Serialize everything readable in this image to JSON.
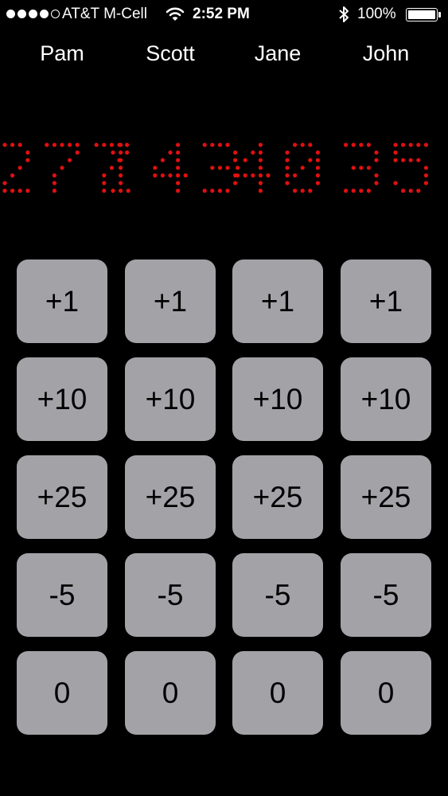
{
  "status_bar": {
    "signal_bars_filled": 4,
    "signal_bars_total": 5,
    "carrier": "AT&T M-Cell",
    "wifi_icon": "wifi-icon",
    "time": "2:52 PM",
    "bluetooth_icon": "bluetooth-icon",
    "battery_percent": "100%",
    "battery_level": 1.0
  },
  "players": [
    {
      "name": "Pam",
      "score": "277"
    },
    {
      "name": "Scott",
      "score": "143"
    },
    {
      "name": "Jane",
      "score": "40"
    },
    {
      "name": "John",
      "score": "35"
    }
  ],
  "button_rows": [
    "+1",
    "+10",
    "+25",
    "-5",
    "0"
  ],
  "colors": {
    "background": "#000000",
    "score_led": "#e01010",
    "button_bg": "#a3a2a7",
    "button_text": "#000000",
    "name_text": "#ffffff"
  }
}
